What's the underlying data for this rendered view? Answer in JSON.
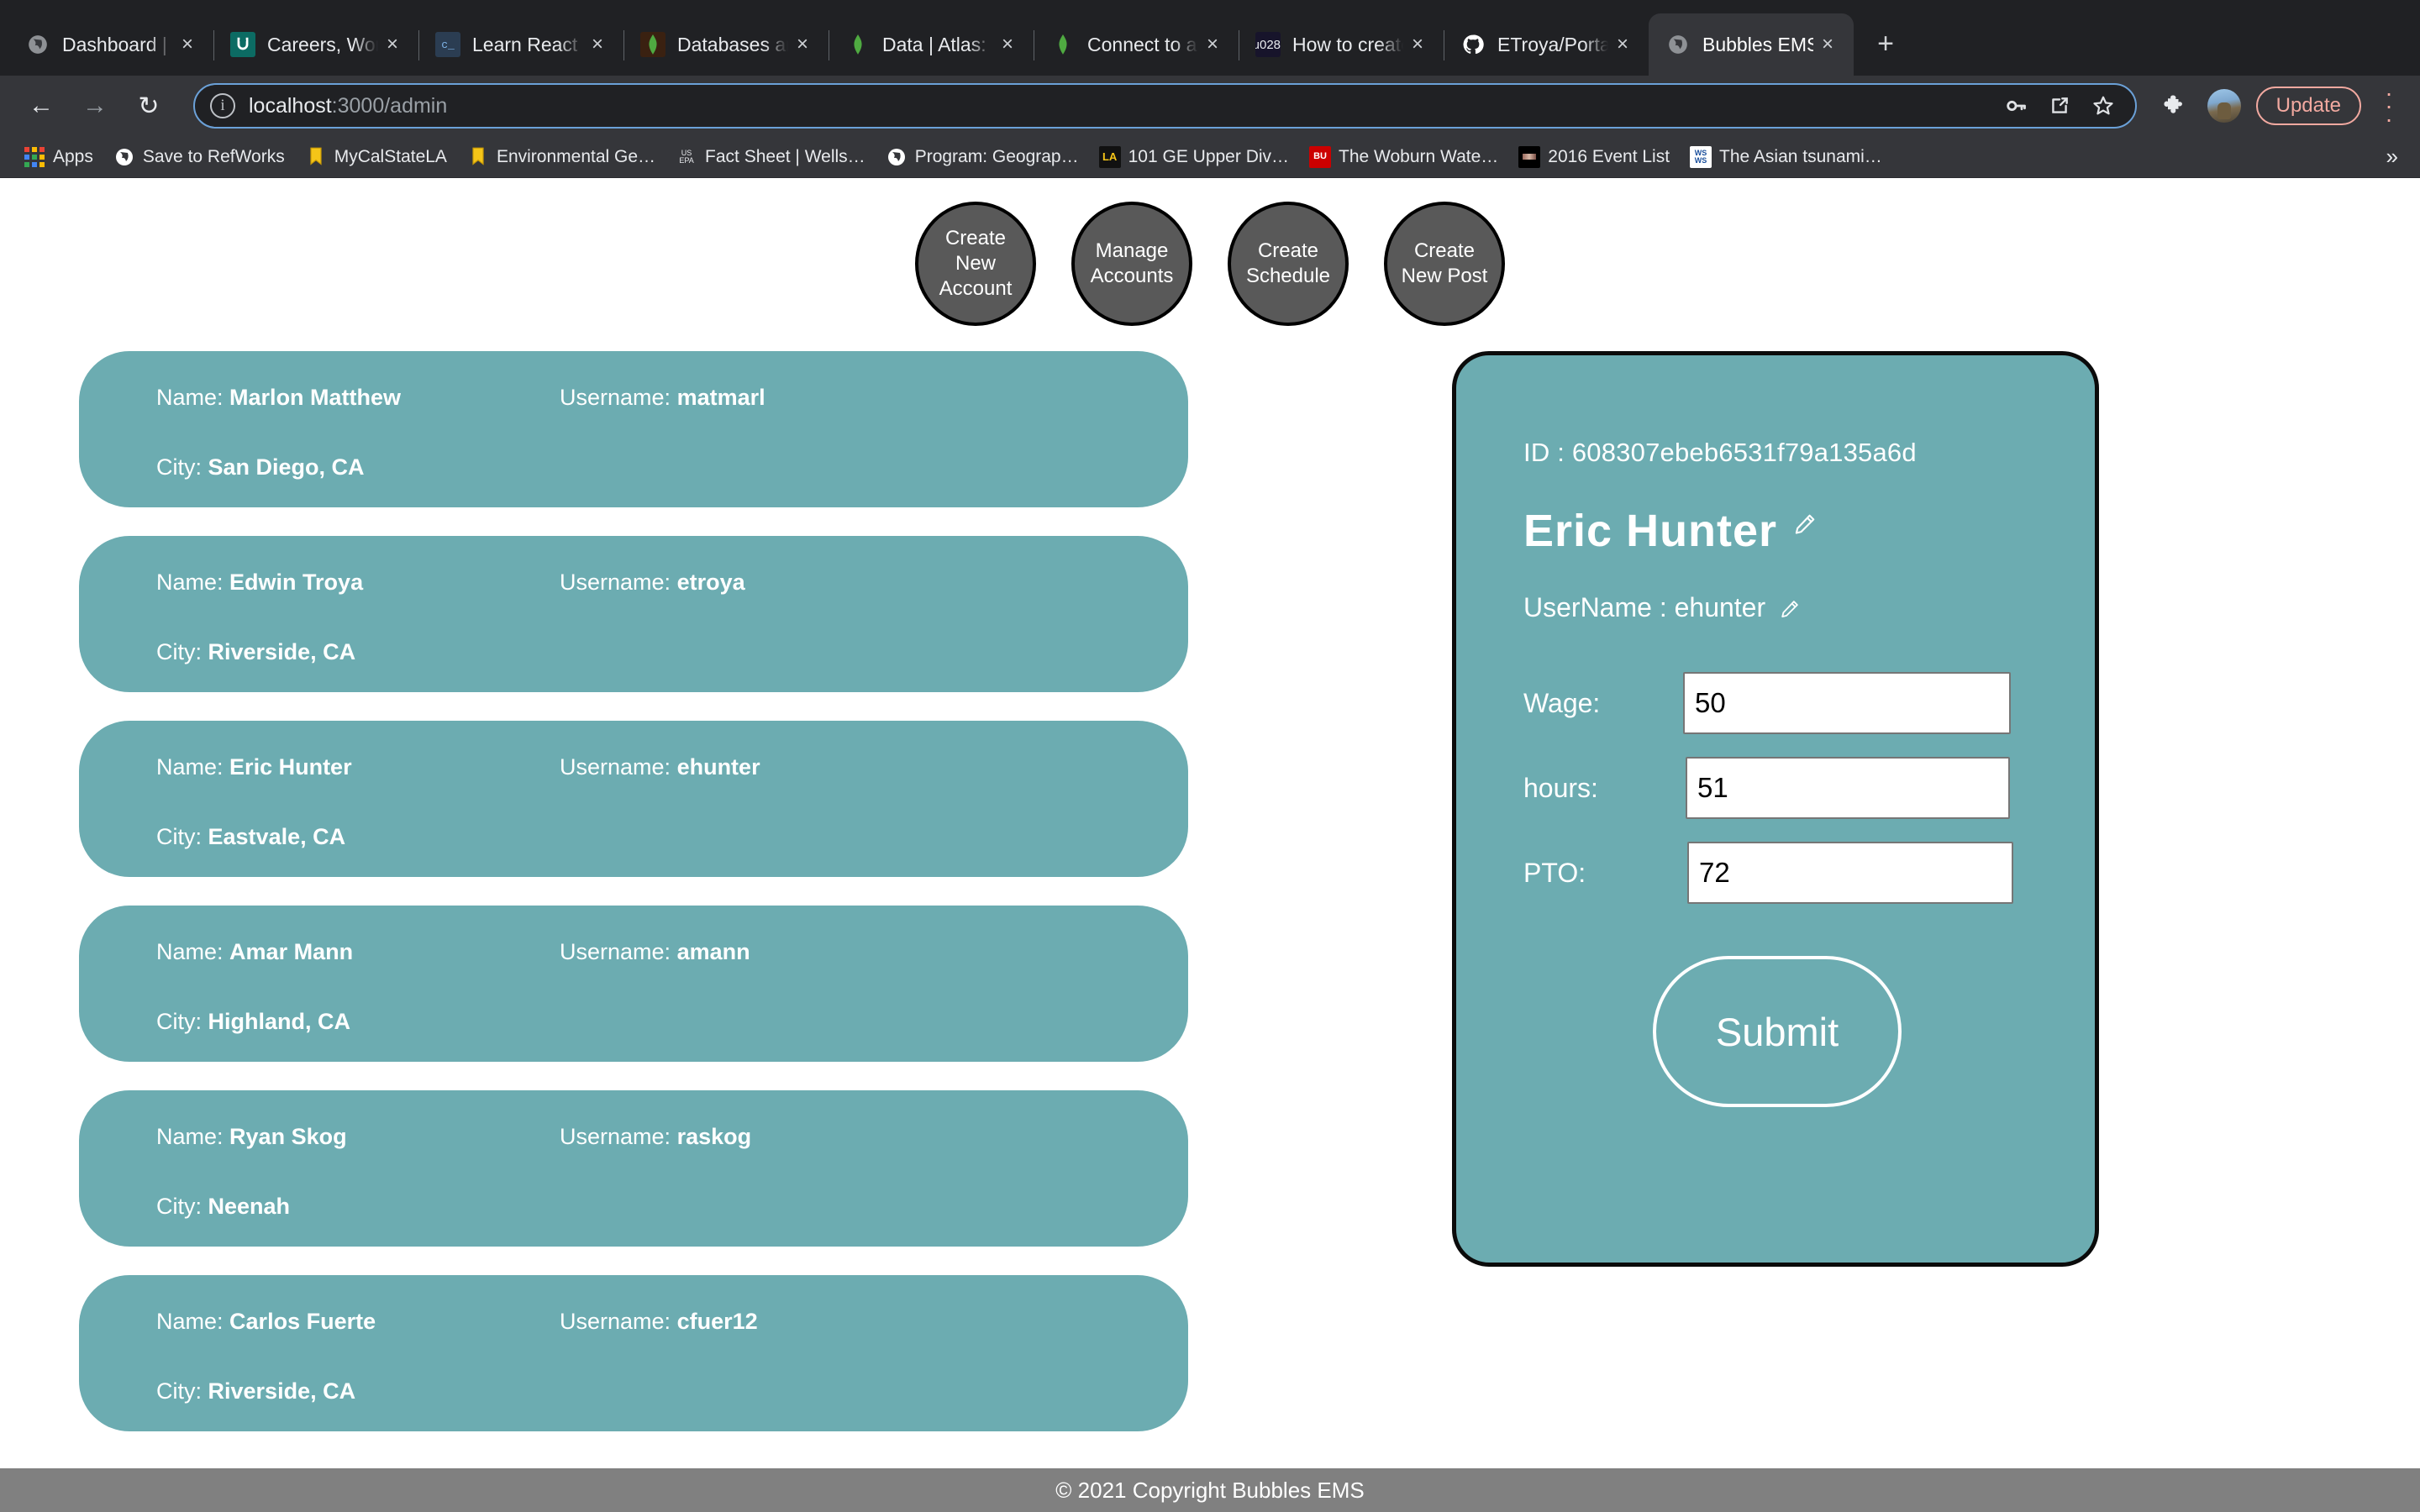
{
  "browser": {
    "tabs": [
      {
        "title": "Dashboard | Bo",
        "favicon": "globe-icon",
        "active": false
      },
      {
        "title": "Careers, Work,",
        "favicon": "handshake-icon",
        "active": false
      },
      {
        "title": "Learn React | C",
        "favicon": "code-icon",
        "active": false
      },
      {
        "title": "Databases and",
        "favicon": "mongodb-icon",
        "active": false
      },
      {
        "title": "Data | Atlas: Mo",
        "favicon": "mongodb-icon",
        "active": false
      },
      {
        "title": "Connect to a M",
        "favicon": "mongodb-icon",
        "active": false
      },
      {
        "title": "How to create y",
        "favicon": "flame-icon",
        "active": false
      },
      {
        "title": "ETroya/Portal-M",
        "favicon": "github-icon",
        "active": false
      },
      {
        "title": "Bubbles EMS",
        "favicon": "globe-icon",
        "active": true
      }
    ],
    "tab_close_label": "×",
    "new_tab_label": "+",
    "nav": {
      "back": "←",
      "forward": "→",
      "reload": "↻"
    },
    "omnibox": {
      "security_icon": "info-circle-icon",
      "url_host": "localhost",
      "url_path": ":3000/admin",
      "actions": [
        {
          "name": "password-key-icon",
          "glyph": "⚷"
        },
        {
          "name": "open-in-new-icon",
          "glyph": "⧉"
        },
        {
          "name": "bookmark-star-icon",
          "glyph": "☆"
        }
      ]
    },
    "toolbar_right": {
      "extensions_icon": "puzzle-piece-icon",
      "profile_avatar": "avatar",
      "update_label": "Update",
      "menu_icon": "kebab-menu-icon"
    },
    "bookmarks": [
      {
        "label": "Apps",
        "icon": "apps-grid-icon"
      },
      {
        "label": "Save to RefWorks",
        "icon": "globe-icon"
      },
      {
        "label": "MyCalStateLA",
        "icon": "bookmark-yellow-icon"
      },
      {
        "label": "Environmental Ge…",
        "icon": "bookmark-yellow-icon"
      },
      {
        "label": "Fact Sheet | Wells…",
        "icon": "us-epa-icon"
      },
      {
        "label": "Program: Geograp…",
        "icon": "globe-icon"
      },
      {
        "label": "101 GE Upper Div…",
        "icon": "la-icon"
      },
      {
        "label": "The Woburn Wate…",
        "icon": "bu-icon"
      },
      {
        "label": "2016 Event List",
        "icon": "photo-icon"
      },
      {
        "label": "The Asian tsunami…",
        "icon": "wsws-icon"
      }
    ],
    "bookmarks_overflow": "»"
  },
  "app": {
    "actions": [
      {
        "label": "Create New Account",
        "name": "create-new-account-button"
      },
      {
        "label": "Manage Accounts",
        "name": "manage-accounts-button"
      },
      {
        "label": "Create Schedule",
        "name": "create-schedule-button"
      },
      {
        "label": "Create New Post",
        "name": "create-new-post-button"
      }
    ],
    "labels": {
      "name_prefix": "Name:",
      "username_prefix": "Username:",
      "city_prefix": "City:"
    },
    "users": [
      {
        "name": "Marlon Matthew",
        "username": "matmarl",
        "city": "San Diego, CA"
      },
      {
        "name": "Edwin Troya",
        "username": "etroya",
        "city": "Riverside, CA"
      },
      {
        "name": "Eric Hunter",
        "username": "ehunter",
        "city": "Eastvale, CA"
      },
      {
        "name": "Amar Mann",
        "username": "amann",
        "city": "Highland, CA"
      },
      {
        "name": "Ryan Skog",
        "username": "raskog",
        "city": "Neenah"
      },
      {
        "name": "Carlos Fuerte",
        "username": "cfuer12",
        "city": "Riverside, CA"
      }
    ],
    "detail": {
      "id_label": "ID :",
      "id_value": "608307ebeb6531f79a135a6d",
      "full_name": "Eric  Hunter",
      "username_label": "UserName :",
      "username_value": "ehunter",
      "edit_name_icon": "pencil-icon",
      "edit_username_icon": "pencil-icon",
      "fields": [
        {
          "label": "Wage:",
          "value": "50",
          "name": "wage-input"
        },
        {
          "label": "hours:",
          "value": "51",
          "name": "hours-input"
        },
        {
          "label": "PTO:",
          "value": "72",
          "name": "pto-input"
        }
      ],
      "submit_label": "Submit"
    },
    "footer": "© 2021 Copyright Bubbles EMS",
    "colors": {
      "card_teal": "#6cacb1",
      "circle_gray": "#595959",
      "footer_gray": "#808080",
      "update_accent": "#f2a9a0"
    }
  }
}
